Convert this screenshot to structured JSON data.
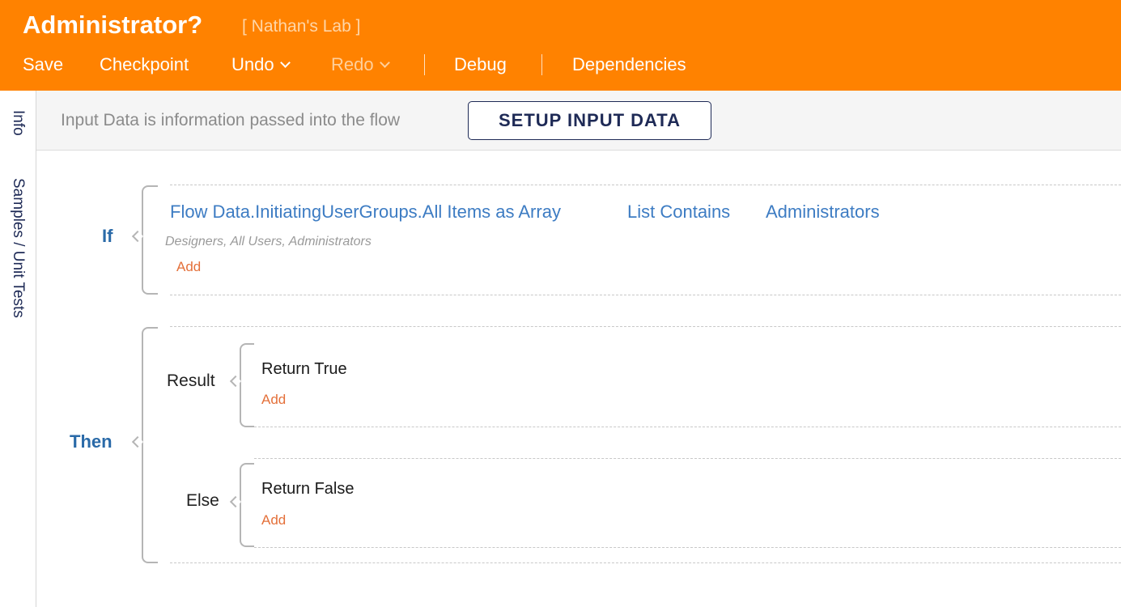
{
  "header": {
    "title": "Administrator?",
    "subtitle": "[ Nathan's Lab ]",
    "toolbar": {
      "save": "Save",
      "checkpoint": "Checkpoint",
      "undo": "Undo",
      "redo": "Redo",
      "debug": "Debug",
      "dependencies": "Dependencies"
    }
  },
  "sidebar": {
    "tabs": [
      "Info",
      "Samples / Unit Tests"
    ]
  },
  "input_bar": {
    "hint": "Input Data is information passed into the flow",
    "button": "SETUP INPUT DATA"
  },
  "if_block": {
    "label": "If",
    "condition": {
      "left": "Flow Data.InitiatingUserGroups.All Items as Array",
      "operator": "List Contains",
      "right": "Administrators",
      "description": "Designers, All Users, Administrators"
    },
    "add": "Add"
  },
  "then_block": {
    "label": "Then",
    "result": {
      "label": "Result",
      "step": "Return True",
      "add": "Add"
    },
    "else": {
      "label": "Else",
      "step": "Return False",
      "add": "Add"
    }
  },
  "colors": {
    "header_bg": "#ff8200",
    "accent_blue": "#3d7cc3",
    "label_blue": "#2a6aa8",
    "add_orange": "#e4703a",
    "navy": "#1e2a56"
  }
}
